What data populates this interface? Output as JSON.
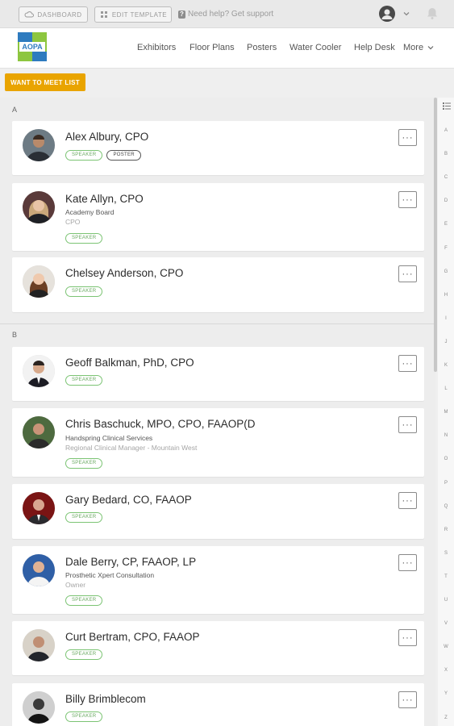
{
  "topbar": {
    "dashboard": "DASHBOARD",
    "edit_template": "EDIT TEMPLATE",
    "help": "Need help? Get support"
  },
  "brand": {
    "logo_text": "AOPA"
  },
  "nav": {
    "exhibitors": "Exhibitors",
    "floor_plans": "Floor Plans",
    "posters": "Posters",
    "water_cooler": "Water Cooler",
    "help_desk": "Help Desk",
    "more": "More"
  },
  "want_to_meet": "WANT TO MEET LIST",
  "sections": [
    {
      "letter": "A",
      "people": [
        {
          "name": "Alex Albury, CPO",
          "org": "",
          "role": "",
          "badges": [
            "SPEAKER",
            "POSTER"
          ]
        },
        {
          "name": "Kate Allyn, CPO",
          "org": "Academy Board",
          "role": "CPO",
          "badges": [
            "SPEAKER"
          ]
        },
        {
          "name": "Chelsey Anderson, CPO",
          "org": "",
          "role": "",
          "badges": [
            "SPEAKER"
          ]
        }
      ]
    },
    {
      "letter": "B",
      "people": [
        {
          "name": "Geoff Balkman, PhD, CPO",
          "org": "",
          "role": "",
          "badges": [
            "SPEAKER"
          ]
        },
        {
          "name": "Chris Baschuck, MPO, CPO, FAAOP(D",
          "org": "Handspring Clinical Services",
          "role": "Regional Clinical Manager - Mountain West",
          "badges": [
            "SPEAKER"
          ]
        },
        {
          "name": "Gary Bedard, CO, FAAOP",
          "org": "",
          "role": "",
          "badges": [
            "SPEAKER"
          ]
        },
        {
          "name": "Dale Berry, CP, FAAOP, LP",
          "org": "Prosthetic Xpert Consultation",
          "role": "Owner",
          "badges": [
            "SPEAKER"
          ]
        },
        {
          "name": "Curt Bertram, CPO, FAAOP",
          "org": "",
          "role": "",
          "badges": [
            "SPEAKER"
          ]
        },
        {
          "name": "Billy Brimblecom",
          "org": "",
          "role": "",
          "badges": [
            "SPEAKER"
          ]
        }
      ]
    }
  ],
  "alphabet": [
    "A",
    "B",
    "C",
    "D",
    "E",
    "F",
    "G",
    "H",
    "I",
    "J",
    "K",
    "L",
    "M",
    "N",
    "O",
    "P",
    "Q",
    "R",
    "S",
    "T",
    "U",
    "V",
    "W",
    "X",
    "Y",
    "Z"
  ],
  "colors": {
    "accent": "#e9a400",
    "speaker_badge": "#7cc474",
    "logo_green": "#8dc63f",
    "logo_blue": "#2e7bbf"
  }
}
